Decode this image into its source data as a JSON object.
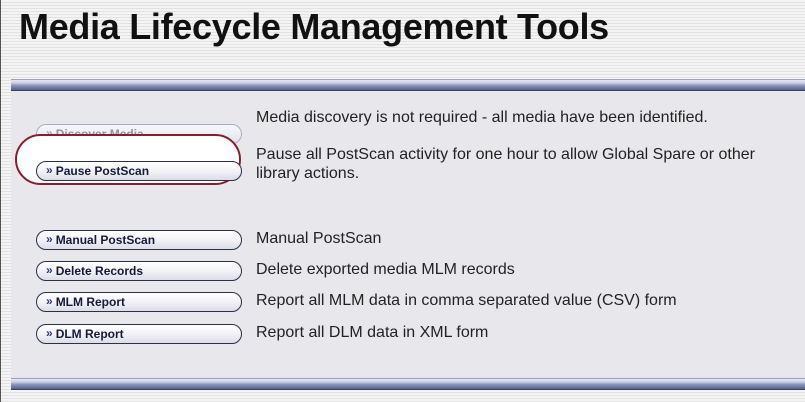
{
  "page": {
    "title": "Media Lifecycle Management Tools"
  },
  "rows": [
    {
      "button_label": "Discover Media",
      "button_state": "disabled",
      "description": "Media discovery is not required - all media have been identified."
    },
    {
      "button_label": "Pause PostScan",
      "button_state": "enabled",
      "highlighted": true,
      "description": "Pause all PostScan activity for one hour to allow Global Spare or other library actions."
    },
    {
      "button_label": "Manual PostScan",
      "button_state": "enabled",
      "description": "Manual PostScan"
    },
    {
      "button_label": "Delete Records",
      "button_state": "enabled",
      "description": "Delete exported media MLM records"
    },
    {
      "button_label": "MLM Report",
      "button_state": "enabled",
      "description": "Report all MLM data in comma separated value (CSV) form"
    },
    {
      "button_label": "DLM Report",
      "button_state": "enabled",
      "description": "Report all DLM data in XML form"
    }
  ],
  "icons": {
    "button_glyph": "double-chevron-right-icon"
  },
  "colors": {
    "button_border": "#2c2f48",
    "disabled_text": "#8c93ab",
    "highlight_ring": "#8a1e26",
    "band_dark": "#57608c"
  }
}
